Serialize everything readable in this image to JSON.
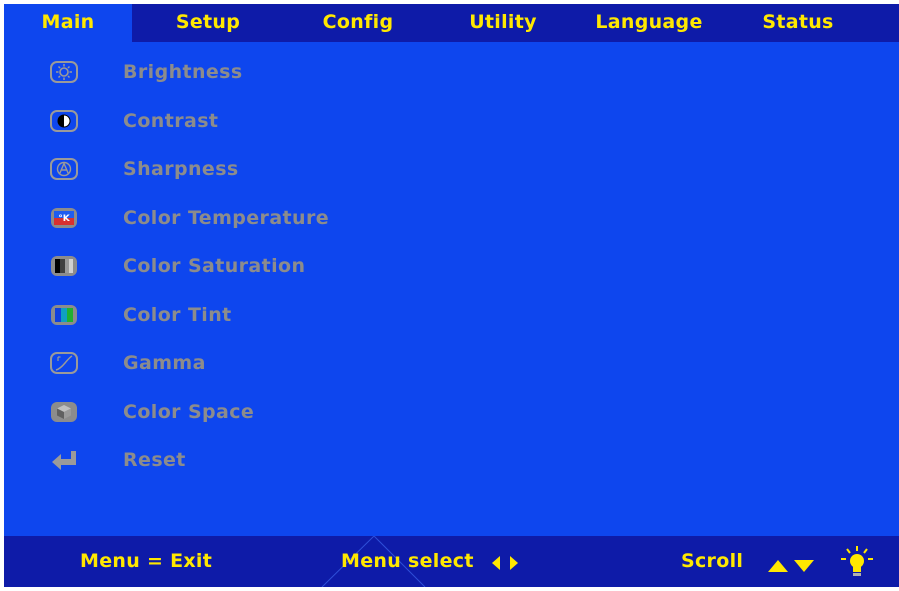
{
  "tabs": [
    {
      "label": "Main",
      "active": true
    },
    {
      "label": "Setup",
      "active": false
    },
    {
      "label": "Config",
      "active": false
    },
    {
      "label": "Utility",
      "active": false
    },
    {
      "label": "Language",
      "active": false
    },
    {
      "label": "Status",
      "active": false
    }
  ],
  "menu": {
    "items": [
      {
        "label": "Brightness",
        "icon": "brightness-icon"
      },
      {
        "label": "Contrast",
        "icon": "contrast-icon"
      },
      {
        "label": "Sharpness",
        "icon": "sharpness-icon"
      },
      {
        "label": "Color Temperature",
        "icon": "color-temperature-icon"
      },
      {
        "label": "Color Saturation",
        "icon": "color-saturation-icon"
      },
      {
        "label": "Color Tint",
        "icon": "color-tint-icon"
      },
      {
        "label": "Gamma",
        "icon": "gamma-icon"
      },
      {
        "label": "Color Space",
        "icon": "color-space-icon"
      },
      {
        "label": "Reset",
        "icon": "reset-icon"
      }
    ]
  },
  "footer": {
    "exit_hint": "Menu = Exit",
    "select_hint": "Menu select",
    "scroll_hint": "Scroll"
  },
  "colors": {
    "panel": "#0e46ee",
    "bar": "#0e1ba8",
    "accent_text": "#ffe800",
    "disabled_text": "#8c8c8c"
  }
}
